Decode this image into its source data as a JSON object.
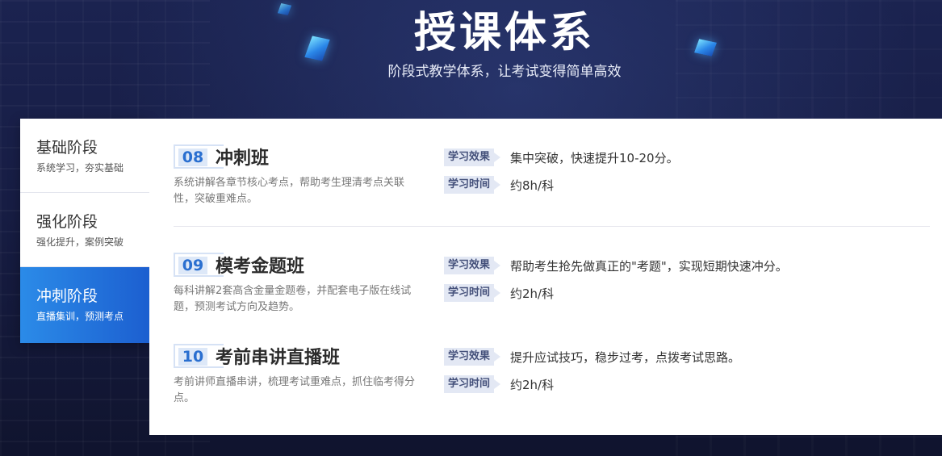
{
  "header": {
    "title": "授课体系",
    "subtitle": "阶段式教学体系，让考试变得简单高效"
  },
  "sidebar": {
    "stages": [
      {
        "name": "基础阶段",
        "desc": "系统学习，夯实基础",
        "active": false
      },
      {
        "name": "强化阶段",
        "desc": "强化提升，案例突破",
        "active": false
      },
      {
        "name": "冲刺阶段",
        "desc": "直播集训，预测考点",
        "active": true
      }
    ]
  },
  "labels": {
    "effect": "学习效果",
    "time": "学习时间"
  },
  "courses": [
    {
      "num": "08",
      "name": "冲刺班",
      "desc": "系统讲解各章节核心考点，帮助考生理清考点关联性，突破重难点。",
      "effect": "集中突破，快速提升10-20分。",
      "time": "约8h/科"
    },
    {
      "num": "09",
      "name": "模考金题班",
      "desc": "每科讲解2套高含金量金题卷，并配套电子版在线试题，预测考试方向及趋势。",
      "effect": "帮助考生抢先做真正的\"考题\"，实现短期快速冲分。",
      "time": "约2h/科"
    },
    {
      "num": "10",
      "name": "考前串讲直播班",
      "desc": "考前讲师直播串讲，梳理考试重难点，抓住临考得分点。",
      "effect": "提升应试技巧，稳步过考，点拨考试思路。",
      "time": "约2h/科"
    }
  ],
  "colors": {
    "accent": "#1c5fd0",
    "background": "#171d44"
  }
}
